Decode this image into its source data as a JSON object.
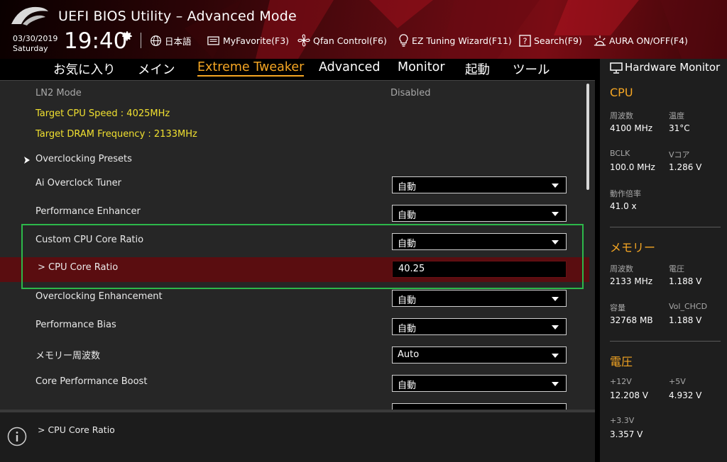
{
  "header": {
    "title": "UEFI BIOS Utility – Advanced Mode",
    "date": "03/30/2019",
    "day": "Saturday",
    "time": "19:40",
    "toolbar": [
      {
        "label": "日本語",
        "icon": "globe-icon"
      },
      {
        "label": "MyFavorite(F3)",
        "icon": "favorite-icon"
      },
      {
        "label": "Qfan Control(F6)",
        "icon": "fan-icon"
      },
      {
        "label": "EZ Tuning Wizard(F11)",
        "icon": "lightbulb-icon"
      },
      {
        "label": "Search(F9)",
        "icon": "search-icon"
      },
      {
        "label": "AURA ON/OFF(F4)",
        "icon": "aura-icon"
      }
    ]
  },
  "tabs": [
    {
      "label": "お気に入り",
      "active": false
    },
    {
      "label": "メイン",
      "active": false
    },
    {
      "label": "Extreme Tweaker",
      "active": true
    },
    {
      "label": "Advanced",
      "active": false
    },
    {
      "label": "Monitor",
      "active": false
    },
    {
      "label": "起動",
      "active": false
    },
    {
      "label": "ツール",
      "active": false
    }
  ],
  "settings": {
    "ln2_mode": {
      "label": "LN2 Mode",
      "value": "Disabled"
    },
    "target_cpu": {
      "label": "Target CPU Speed : 4025MHz"
    },
    "target_dram": {
      "label": "Target DRAM Frequency : 2133MHz"
    },
    "oc_presets": {
      "label": "Overclocking Presets"
    },
    "ai_tuner": {
      "label": "Ai Overclock Tuner",
      "value": "自動"
    },
    "perf_enhancer": {
      "label": "Performance Enhancer",
      "value": "自動"
    },
    "custom_ratio": {
      "label": "Custom CPU Core Ratio",
      "value": "自動"
    },
    "core_ratio": {
      "label": "> CPU Core Ratio",
      "value": "40.25"
    },
    "oc_enhancement": {
      "label": "Overclocking Enhancement",
      "value": "自動"
    },
    "perf_bias": {
      "label": "Performance Bias",
      "value": "自動"
    },
    "mem_freq": {
      "label": "メモリー周波数",
      "value": "Auto"
    },
    "core_boost": {
      "label": "Core Performance Boost",
      "value": "自動"
    }
  },
  "help": {
    "text": "> CPU Core Ratio"
  },
  "hardware_monitor": {
    "title": "Hardware Monitor",
    "cpu": {
      "title": "CPU",
      "freq_label": "周波数",
      "freq_value": "4100 MHz",
      "temp_label": "温度",
      "temp_value": "31°C",
      "bclk_label": "BCLK",
      "bclk_value": "100.0 MHz",
      "vcore_label": "Vコア",
      "vcore_value": "1.286 V",
      "ratio_label": "動作倍率",
      "ratio_value": "41.0 x"
    },
    "memory": {
      "title": "メモリー",
      "freq_label": "周波数",
      "freq_value": "2133 MHz",
      "volt_label": "電圧",
      "volt_value": "1.188 V",
      "cap_label": "容量",
      "cap_value": "32768 MB",
      "vol_chcd_label": "Vol_CHCD",
      "vol_chcd_value": "1.188 V"
    },
    "voltage": {
      "title": "電圧",
      "v12_label": "+12V",
      "v12_value": "12.208 V",
      "v5_label": "+5V",
      "v5_value": "4.932 V",
      "v33_label": "+3.3V",
      "v33_value": "3.357 V"
    }
  }
}
